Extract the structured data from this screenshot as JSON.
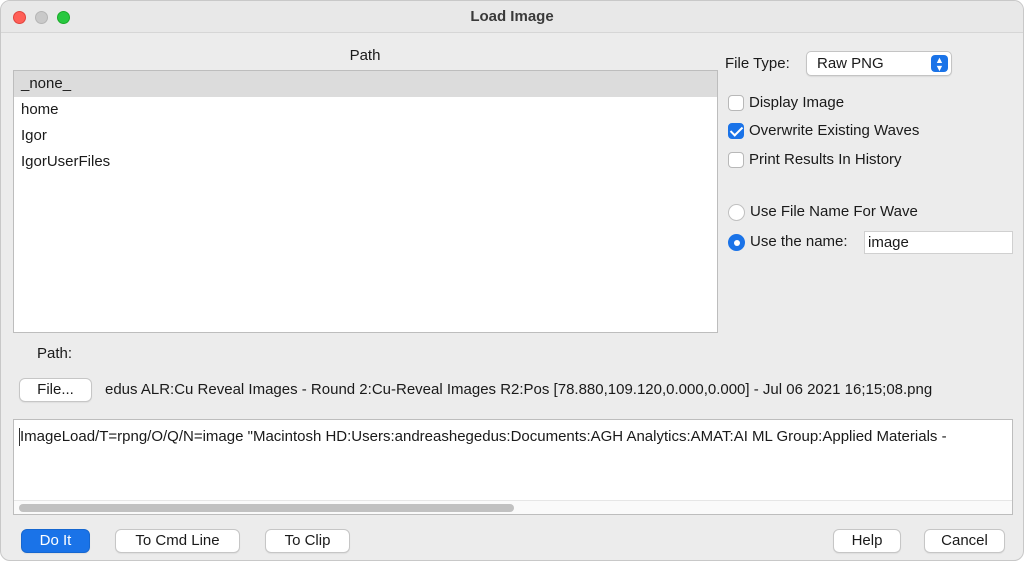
{
  "window": {
    "title": "Load Image"
  },
  "path_panel": {
    "header": "Path",
    "items": [
      "_none_",
      "home",
      "Igor",
      "IgorUserFiles"
    ],
    "selected_index": 0,
    "path_label": "Path:"
  },
  "file_type": {
    "label": "File Type:",
    "value": "Raw PNG"
  },
  "options": {
    "display_image": {
      "label": "Display Image",
      "checked": false
    },
    "overwrite_waves": {
      "label": "Overwrite Existing Waves",
      "checked": true
    },
    "print_results": {
      "label": "Print Results In History",
      "checked": false
    }
  },
  "naming": {
    "use_file_name": {
      "label": "Use File Name For Wave",
      "selected": false
    },
    "use_the_name": {
      "label": "Use the name:",
      "selected": true
    },
    "name_value": "image"
  },
  "file_button": {
    "label": "File..."
  },
  "file_path_text": "edus ALR:Cu Reveal Images - Round 2:Cu-Reveal Images R2:Pos [78.880,109.120,0.000,0.000] - Jul 06 2021 16;15;08.png",
  "command_text": "ImageLoad/T=rpng/O/Q/N=image \"Macintosh HD:Users:andreashegedus:Documents:AGH Analytics:AMAT:AI ML Group:Applied Materials - ",
  "buttons": {
    "do_it": "Do It",
    "to_cmd_line": "To Cmd Line",
    "to_clip": "To Clip",
    "help": "Help",
    "cancel": "Cancel"
  },
  "colors": {
    "accent": "#1a73e8",
    "window_bg": "#ececec",
    "selection": "#dcdcdc"
  }
}
